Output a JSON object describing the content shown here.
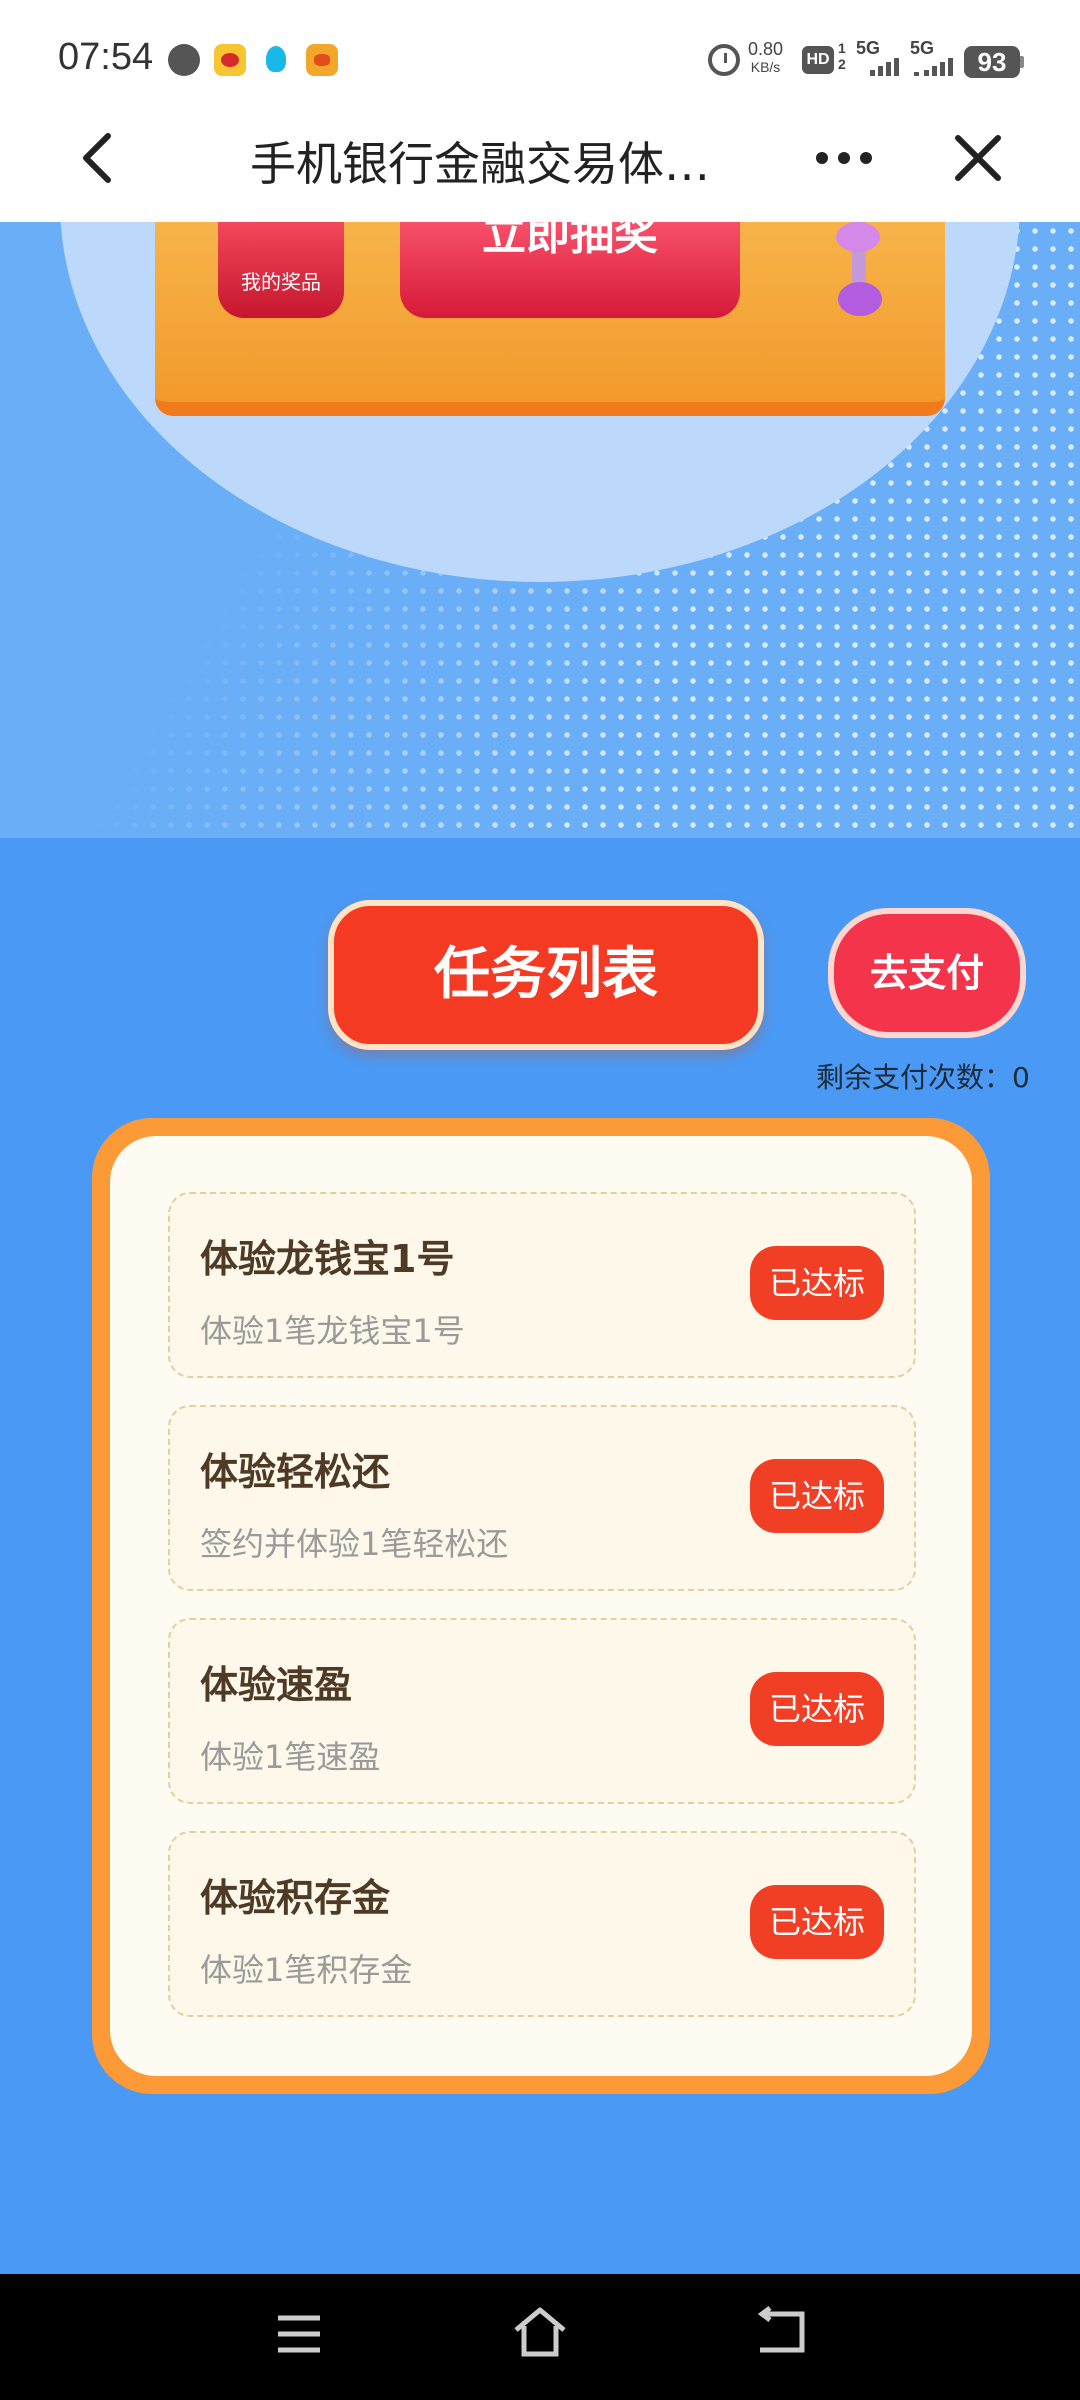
{
  "status_bar": {
    "time": "07:54",
    "net_speed_value": "0.80",
    "net_speed_unit": "KB/s",
    "signal_1": "5G",
    "signal_2": "5G",
    "battery": "93",
    "notification_icons": [
      "chat-icon",
      "weibo-icon",
      "qq-icon",
      "fox-icon"
    ]
  },
  "title_bar": {
    "title": "手机银行金融交易体…"
  },
  "hero": {
    "my_prizes_label": "我的奖品",
    "draw_button_label": "立即抽奖"
  },
  "tasks": {
    "header": "任务列表",
    "pay_button": "去支付",
    "remaining_label": "剩余支付次数：",
    "remaining_value": "0",
    "items": [
      {
        "name": "体验龙钱宝1号",
        "desc": "体验1笔龙钱宝1号",
        "status": "已达标"
      },
      {
        "name": "体验轻松还",
        "desc": "签约并体验1笔轻松还",
        "status": "已达标"
      },
      {
        "name": "体验速盈",
        "desc": "体验1笔速盈",
        "status": "已达标"
      },
      {
        "name": "体验积存金",
        "desc": "体验1笔积存金",
        "status": "已达标"
      }
    ]
  },
  "colors": {
    "page_bg": "#4a9af5",
    "accent_red": "#f13f26",
    "card_orange": "#fb9a36"
  }
}
